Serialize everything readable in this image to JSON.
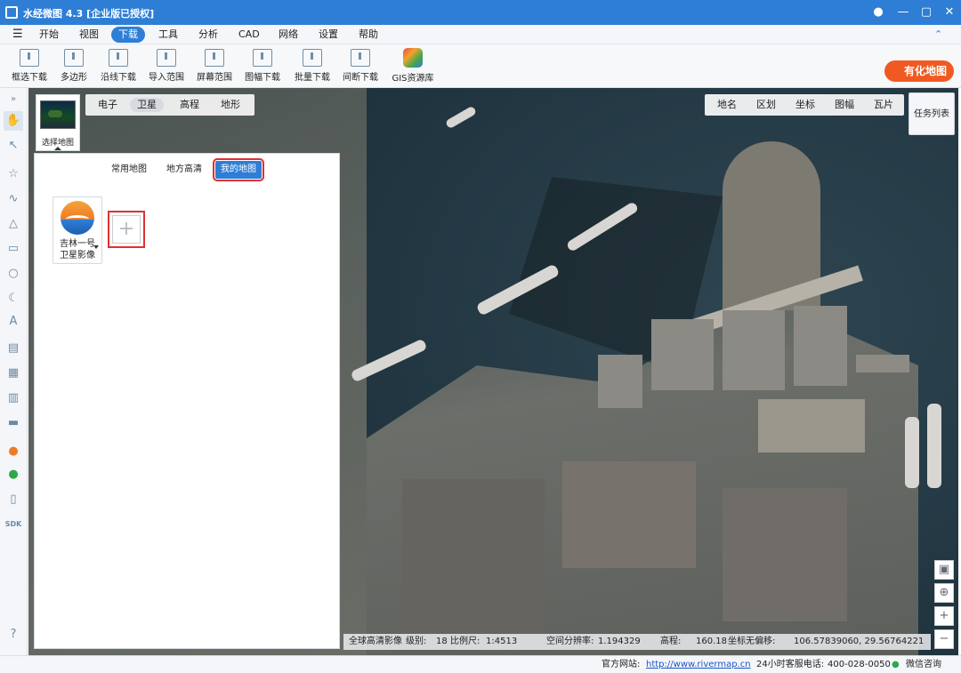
{
  "app": {
    "title": "水经微图 4.3 [企业版已授权]"
  },
  "menu": {
    "items": [
      "开始",
      "视图",
      "下载",
      "工具",
      "分析",
      "CAD",
      "网络",
      "设置",
      "帮助"
    ],
    "active": "下载"
  },
  "toolbar": {
    "items": [
      "框选下载",
      "多边形",
      "沿线下载",
      "导入范围",
      "屏幕范围",
      "图幅下载",
      "批量下载",
      "间断下载",
      "GIS资源库"
    ]
  },
  "promo": {
    "label": "有化地图"
  },
  "map_types": {
    "items": [
      "电子",
      "卫星",
      "高程",
      "地形"
    ],
    "active": "卫星"
  },
  "map_tools": {
    "items": [
      "地名",
      "区划",
      "坐标",
      "图幅",
      "瓦片"
    ]
  },
  "task_list": {
    "label": "任务列表"
  },
  "selector": {
    "label": "选择地图"
  },
  "panel": {
    "tabs": [
      "常用地图",
      "地方高清",
      "我的地图"
    ],
    "active_tab": "我的地图",
    "cards": [
      {
        "line1": "吉林一号",
        "line2": "卫星影像"
      }
    ],
    "add_symbol": "+"
  },
  "map_status": {
    "layer": "全球高清影像",
    "level_label": "级别:",
    "level": "18",
    "scale_label": "比例尺:",
    "scale": "1:4513",
    "res_label": "空间分辨率:",
    "res": "1.194329",
    "elev_label": "高程:",
    "elev": "160.18",
    "offset_label": "坐标无偏移:",
    "coords": "106.57839060, 29.56764221"
  },
  "statusbar": {
    "site_label": "官方网站:",
    "site_url": "http://www.rivermap.cn",
    "phone_label": "24小时客服电话:",
    "phone": "400-028-0050",
    "wechat": "微信咨询"
  },
  "zoom": {
    "in": "+",
    "out": "−"
  },
  "colors": {
    "accent": "#2e7ed6",
    "highlight": "#e03030",
    "promo": "#f05a22"
  }
}
